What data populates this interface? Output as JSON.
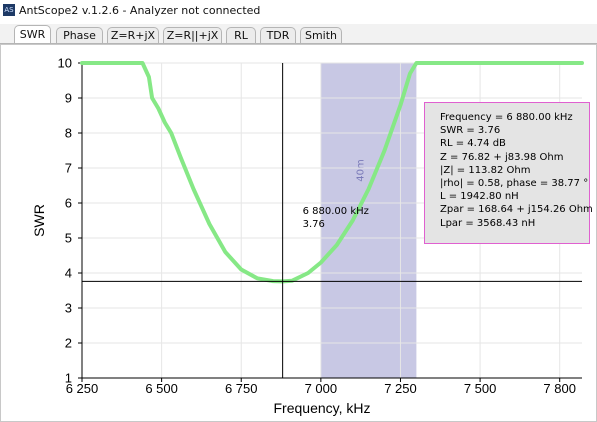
{
  "window": {
    "title": "AntScope2 v.1.2.6 - Analyzer not connected",
    "icon_label": "AS"
  },
  "tabs": [
    {
      "label": "SWR",
      "active": true
    },
    {
      "label": "Phase",
      "active": false
    },
    {
      "label": "Z=R+jX",
      "active": false
    },
    {
      "label": "Z=R||+jX",
      "active": false
    },
    {
      "label": "RL",
      "active": false
    },
    {
      "label": "TDR",
      "active": false
    },
    {
      "label": "Smith",
      "active": false
    }
  ],
  "marker": {
    "freq_label": "6 880.00 kHz",
    "swr_label": "3.76"
  },
  "info": [
    "Frequency = 6 880.00 kHz",
    "SWR = 3.76",
    "RL = 4.74 dB",
    "Z = 76.82 + j83.98 Ohm",
    "|Z| = 113.82 Ohm",
    "|rho| = 0.58, phase = 38.77 °",
    "L = 1942.80 nH",
    "Zpar = 168.64 + j154.26 Ohm",
    "Lpar = 3568.43 nH"
  ],
  "colors": {
    "curve": "#86e886",
    "band": "#c8c8e4",
    "band_label": "#7a7ab8",
    "info_border": "#e060d0",
    "info_bg": "#e4e4e4"
  },
  "chart_data": {
    "type": "line",
    "xlabel": "Frequency, kHz",
    "ylabel": "SWR",
    "xlim": [
      6250,
      6800
    ],
    "ylim": [
      1,
      10
    ],
    "x_ticks": [
      6250,
      6500,
      6750,
      7000,
      7250,
      7500,
      7750
    ],
    "x_tick_labels": [
      "6 250",
      "6 500",
      "6 750",
      "7 000",
      "7 250",
      "7 500",
      "7 800"
    ],
    "y_ticks": [
      1,
      2,
      3,
      4,
      5,
      6,
      7,
      8,
      9,
      10
    ],
    "y_tick_labels": [
      "1",
      "2",
      "3",
      "4",
      "5",
      "6",
      "7",
      "8",
      "9",
      "10"
    ],
    "band": {
      "x_range": [
        7000,
        7300
      ],
      "label": "40m"
    },
    "cursor": {
      "x": 6880,
      "y": 3.76
    },
    "series": [
      {
        "values": [
          [
            6250,
            10
          ],
          [
            6300,
            10
          ],
          [
            6350,
            10
          ],
          [
            6400,
            10
          ],
          [
            6440,
            10
          ],
          [
            6460,
            9.6
          ],
          [
            6470,
            9.0
          ],
          [
            6490,
            8.7
          ],
          [
            6510,
            8.3
          ],
          [
            6530,
            8.0
          ],
          [
            6560,
            7.3
          ],
          [
            6600,
            6.4
          ],
          [
            6650,
            5.4
          ],
          [
            6700,
            4.6
          ],
          [
            6750,
            4.1
          ],
          [
            6800,
            3.85
          ],
          [
            6850,
            3.77
          ],
          [
            6880,
            3.76
          ],
          [
            6910,
            3.78
          ],
          [
            6960,
            4.0
          ],
          [
            7000,
            4.3
          ],
          [
            7050,
            4.8
          ],
          [
            7100,
            5.5
          ],
          [
            7150,
            6.4
          ],
          [
            7200,
            7.5
          ],
          [
            7250,
            8.8
          ],
          [
            7280,
            9.7
          ],
          [
            7300,
            10
          ],
          [
            7350,
            10
          ],
          [
            7400,
            10
          ],
          [
            7500,
            10
          ],
          [
            7600,
            10
          ],
          [
            7700,
            10
          ],
          [
            7800,
            10
          ],
          [
            7820,
            10
          ]
        ]
      }
    ]
  }
}
